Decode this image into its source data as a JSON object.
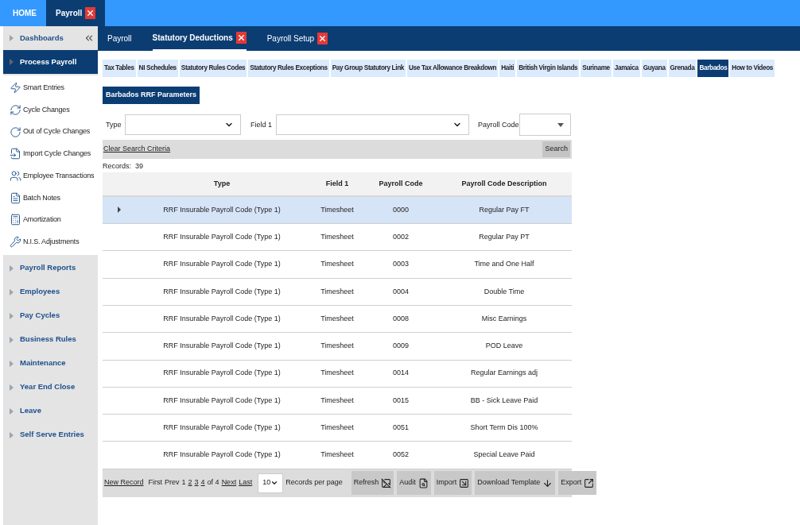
{
  "top_tabs": [
    {
      "label": "HOME",
      "selected": false,
      "closable": false
    },
    {
      "label": "Payroll",
      "selected": true,
      "closable": true
    }
  ],
  "sidebar": {
    "items": [
      {
        "label": "Dashboards",
        "selected": false
      },
      {
        "label": "Process Payroll",
        "selected": true,
        "children": [
          {
            "label": "Smart Entries"
          },
          {
            "label": "Cycle Changes"
          },
          {
            "label": "Out of Cycle Changes"
          },
          {
            "label": "Import Cycle Changes"
          },
          {
            "label": "Employee Transactions"
          },
          {
            "label": "Batch Notes"
          },
          {
            "label": "Amortization"
          },
          {
            "label": "N.I.S. Adjustments"
          }
        ]
      },
      {
        "label": "Payroll Reports",
        "selected": false
      },
      {
        "label": "Employees",
        "selected": false
      },
      {
        "label": "Pay Cycles",
        "selected": false
      },
      {
        "label": "Business Rules",
        "selected": false
      },
      {
        "label": "Maintenance",
        "selected": false
      },
      {
        "label": "Year End Close",
        "selected": false
      },
      {
        "label": "Leave",
        "selected": false
      },
      {
        "label": "Self Serve Entries",
        "selected": false
      }
    ]
  },
  "module_tabs": [
    {
      "label": "Payroll",
      "selected": false,
      "closable": false
    },
    {
      "label": "Statutory Deductions",
      "selected": true,
      "closable": true
    },
    {
      "label": "Payroll Setup",
      "selected": false,
      "closable": true
    }
  ],
  "sub_tabs": [
    {
      "label": "Tax Tables",
      "selected": false
    },
    {
      "label": "NI Schedules",
      "selected": false
    },
    {
      "label": "Statutory Rules Codes",
      "selected": false
    },
    {
      "label": "Statutory Rules Exceptions",
      "selected": false
    },
    {
      "label": "Pay Group Statutory Link",
      "selected": false
    },
    {
      "label": "Use Tax Allowance Breakdown",
      "selected": false
    },
    {
      "label": "Haiti",
      "selected": false
    },
    {
      "label": "British Virgin Islands",
      "selected": false
    },
    {
      "label": "Suriname",
      "selected": false
    },
    {
      "label": "Jamaica",
      "selected": false
    },
    {
      "label": "Guyana",
      "selected": false
    },
    {
      "label": "Grenada",
      "selected": false
    },
    {
      "label": "Barbados",
      "selected": true
    },
    {
      "label": "How to Videos",
      "selected": false
    }
  ],
  "section_button": "Barbados RRF Parameters",
  "filters": {
    "type_label": "Type",
    "field1_label": "Field 1",
    "payroll_code_label": "Payroll Code"
  },
  "clear_link": "Clear Search Criteria",
  "search_button": "Search",
  "records": "Records:  39",
  "table": {
    "columns": [
      "Type",
      "Field 1",
      "Payroll Code",
      "Payroll Code Description"
    ],
    "rows": [
      {
        "cells": [
          "RRF Insurable Payroll Code (Type 1)",
          "Timesheet",
          "0000",
          "Regular Pay FT"
        ],
        "selected": true
      },
      {
        "cells": [
          "RRF Insurable Payroll Code (Type 1)",
          "Timesheet",
          "0002",
          "Regular Pay PT"
        ],
        "selected": false
      },
      {
        "cells": [
          "RRF Insurable Payroll Code (Type 1)",
          "Timesheet",
          "0003",
          "Time and One Half"
        ],
        "selected": false
      },
      {
        "cells": [
          "RRF Insurable Payroll Code (Type 1)",
          "Timesheet",
          "0004",
          "Double Time"
        ],
        "selected": false
      },
      {
        "cells": [
          "RRF Insurable Payroll Code (Type 1)",
          "Timesheet",
          "0008",
          "Misc Earnings"
        ],
        "selected": false
      },
      {
        "cells": [
          "RRF Insurable Payroll Code (Type 1)",
          "Timesheet",
          "0009",
          "POD Leave"
        ],
        "selected": false
      },
      {
        "cells": [
          "RRF Insurable Payroll Code (Type 1)",
          "Timesheet",
          "0014",
          "Regular Earnings adj"
        ],
        "selected": false
      },
      {
        "cells": [
          "RRF Insurable Payroll Code (Type 1)",
          "Timesheet",
          "0015",
          "BB - Sick Leave Paid"
        ],
        "selected": false
      },
      {
        "cells": [
          "RRF Insurable Payroll Code (Type 1)",
          "Timesheet",
          "0051",
          "Short Term Dis 100%"
        ],
        "selected": false
      },
      {
        "cells": [
          "RRF Insurable Payroll Code (Type 1)",
          "Timesheet",
          "0052",
          "Special Leave Paid"
        ],
        "selected": false
      }
    ]
  },
  "footer": {
    "new_record": "New Record",
    "pager": [
      {
        "label": "First",
        "disabled": true
      },
      {
        "label": "Prev",
        "disabled": true
      },
      {
        "label": "1",
        "disabled": true
      },
      {
        "label": "2",
        "disabled": false
      },
      {
        "label": "3",
        "disabled": false
      },
      {
        "label": "4",
        "disabled": false
      },
      {
        "label": "of 4",
        "disabled": true
      },
      {
        "label": "Next",
        "disabled": false
      },
      {
        "label": "Last",
        "disabled": false
      }
    ],
    "per_page": "10",
    "per_page_label": "Records per page",
    "buttons": [
      "Refresh",
      "Audit",
      "Import",
      "Download Template",
      "Export"
    ]
  }
}
